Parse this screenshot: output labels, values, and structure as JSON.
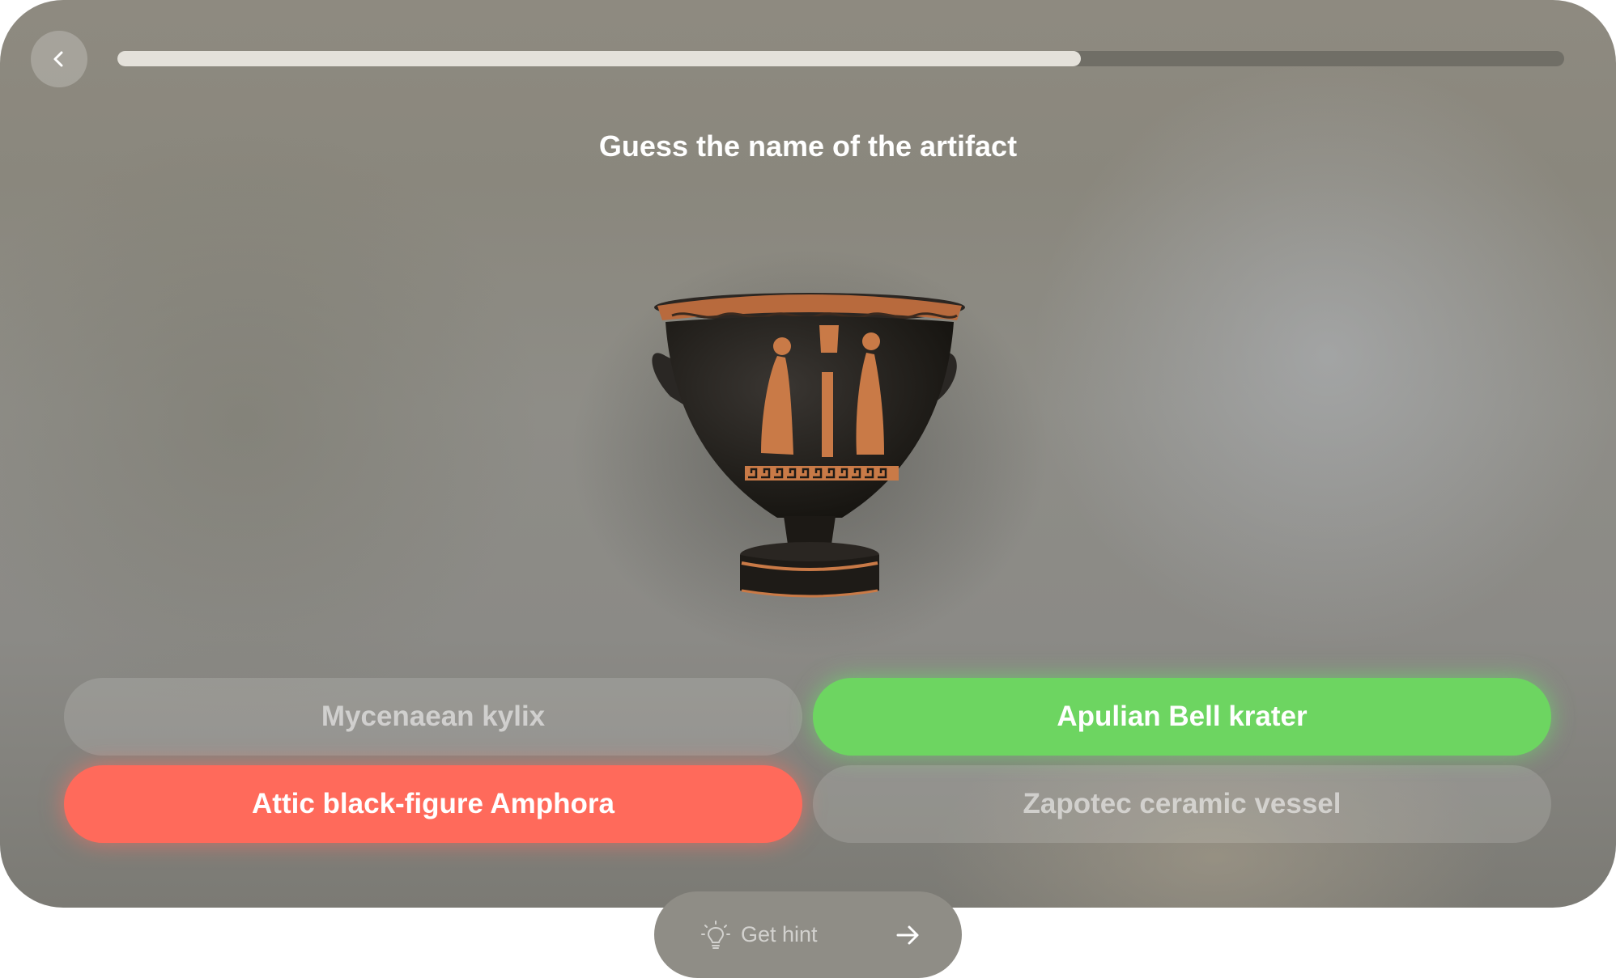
{
  "quiz": {
    "title": "Guess the name of the artifact",
    "progress": 0.666
  },
  "answers": [
    {
      "label": "Mycenaean kylix",
      "state": "neutral"
    },
    {
      "label": "Apulian Bell krater",
      "state": "correct",
      "color": "#6dd561"
    },
    {
      "label": "Attic black-figure Amphora",
      "state": "wrong",
      "color": "#ff6a5b"
    },
    {
      "label": "Zapotec ceramic vessel",
      "state": "neutral"
    }
  ],
  "hint": {
    "label": "Get hint"
  },
  "icons": {
    "back": "chevron-left-icon",
    "hint": "lightbulb-icon",
    "next": "arrow-right-icon",
    "artifact": "bell-krater-vase-image"
  }
}
